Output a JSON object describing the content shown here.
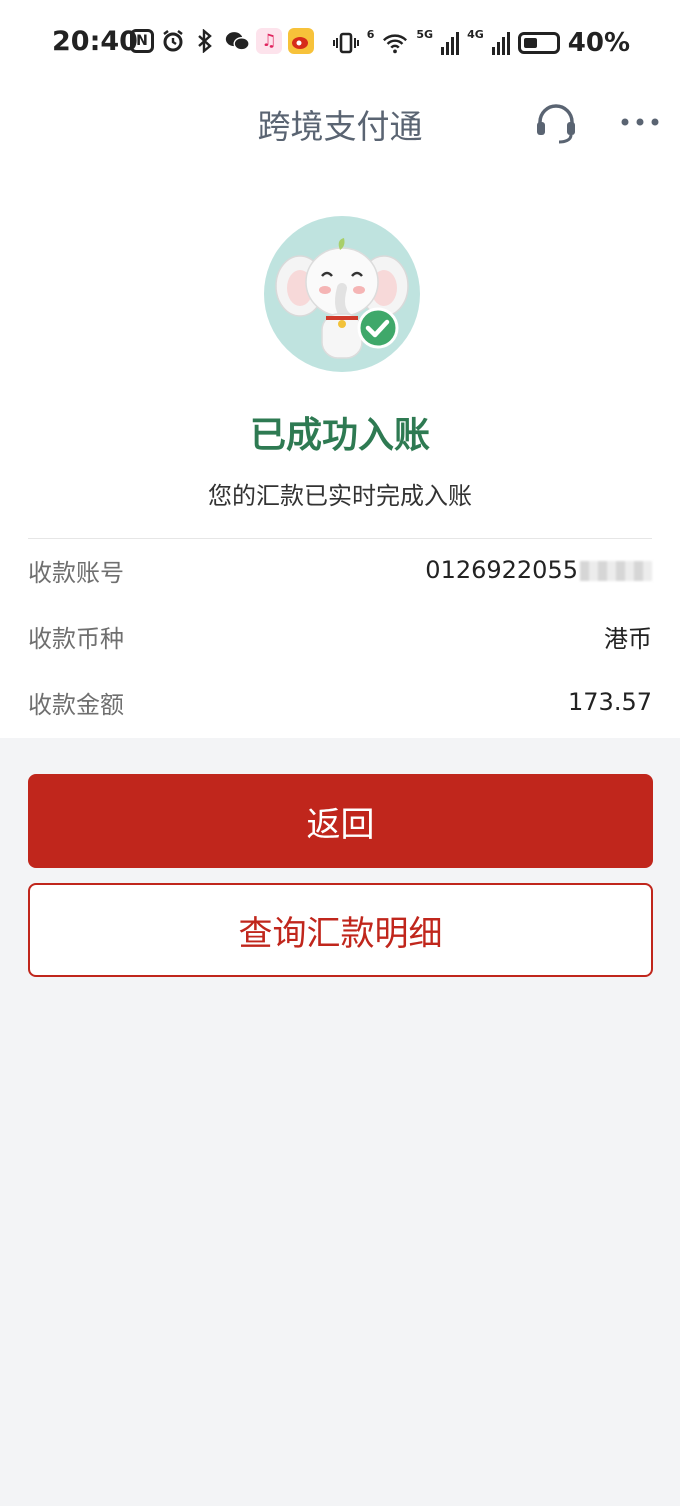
{
  "status_bar": {
    "time": "20:40",
    "nfc_glyph": "N",
    "network_5g": "5G",
    "network_4g": "4G",
    "wifi_badge": "6",
    "battery": "40%",
    "battery_level": 0.4
  },
  "nav": {
    "title": "跨境支付通",
    "icons": [
      "headset-icon",
      "more-icon"
    ]
  },
  "result": {
    "title": "已成功入账",
    "subtitle": "您的汇款已实时完成入账",
    "title_color": "#2e7a52"
  },
  "details": [
    {
      "label": "收款账号",
      "value": "0126922055"
    },
    {
      "label": "收款币种",
      "value": "港币"
    },
    {
      "label": "收款金额",
      "value": "173.57"
    }
  ],
  "actions": {
    "back_label": "返回",
    "query_label": "查询汇款明细",
    "accent_color": "#c0261c"
  }
}
